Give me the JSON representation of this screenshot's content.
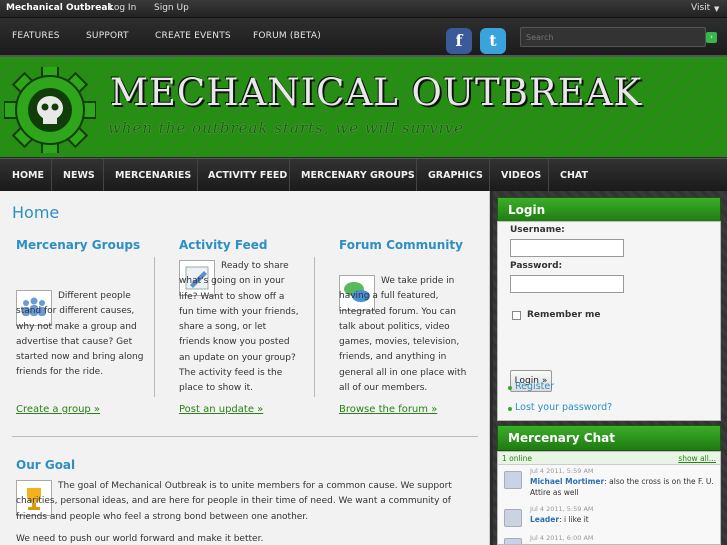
{
  "topbar": {
    "brand": "Mechanical Outbreak",
    "login": "Log In",
    "signup": "Sign Up",
    "visit": "Visit"
  },
  "secondary_nav": [
    "FEATURES",
    "SUPPORT",
    "CREATE EVENTS",
    "FORUM (BETA)"
  ],
  "search": {
    "placeholder": "Search"
  },
  "banner": {
    "title": "MECHANICAL OUTBREAK",
    "tagline": "when the outbreak starts, we will survive"
  },
  "main_nav": [
    "HOME",
    "NEWS",
    "MERCENARIES",
    "ACTIVITY FEED",
    "MERCENARY GROUPS",
    "GRAPHICS",
    "VIDEOS",
    "CHAT"
  ],
  "page": {
    "title": "Home",
    "columns": [
      {
        "title": "Mercenary Groups",
        "text": "Different people stand for different causes, why not make a group and advertise that cause? Get started now and bring along friends for the ride.",
        "link": "Create a group »"
      },
      {
        "title": "Activity Feed",
        "text": "Ready to share what's going on in your life? Want to show off a fun time with your friends, share a song, or let friends know you posted an update on your group? The activity feed is the place to show it.",
        "link": "Post an update »"
      },
      {
        "title": "Forum Community",
        "text": "We take pride in having a full featured, integrated forum. You can talk about politics, video games, movies, television, friends, and anything in general all in one place with all of our members.",
        "link": "Browse the forum »"
      }
    ],
    "goal": {
      "title": "Our Goal",
      "text": "The goal of Mechanical Outbreak is to unite members for a common cause. We support charities, personal ideas, and are here for people in their time of need. We want a community of friends and people who feel a strong bond between one another.",
      "text2": "We need to push our world forward and make it better."
    }
  },
  "login": {
    "title": "Login",
    "username_label": "Username:",
    "password_label": "Password:",
    "remember": "Remember me",
    "button": "Login »",
    "register": "Register",
    "lost_password": "Lost your password?"
  },
  "chat": {
    "title": "Mercenary Chat",
    "online": "1 online",
    "show_all": "show all...",
    "messages": [
      {
        "time": "Jul 4 2011, 5:59 AM",
        "user": "Michael Mortimer",
        "text": "also the cross is on the F. U. Attire as well"
      },
      {
        "time": "Jul 4 2011, 5:59 AM",
        "user": "Leader",
        "text": "i like it"
      },
      {
        "time": "Jul 4 2011, 6:00 AM",
        "user": "",
        "text": ""
      }
    ]
  },
  "colors": {
    "accent_blue": "#2d8fc4",
    "brand_green": "#2a8b18",
    "link_green": "#2a7f18"
  }
}
